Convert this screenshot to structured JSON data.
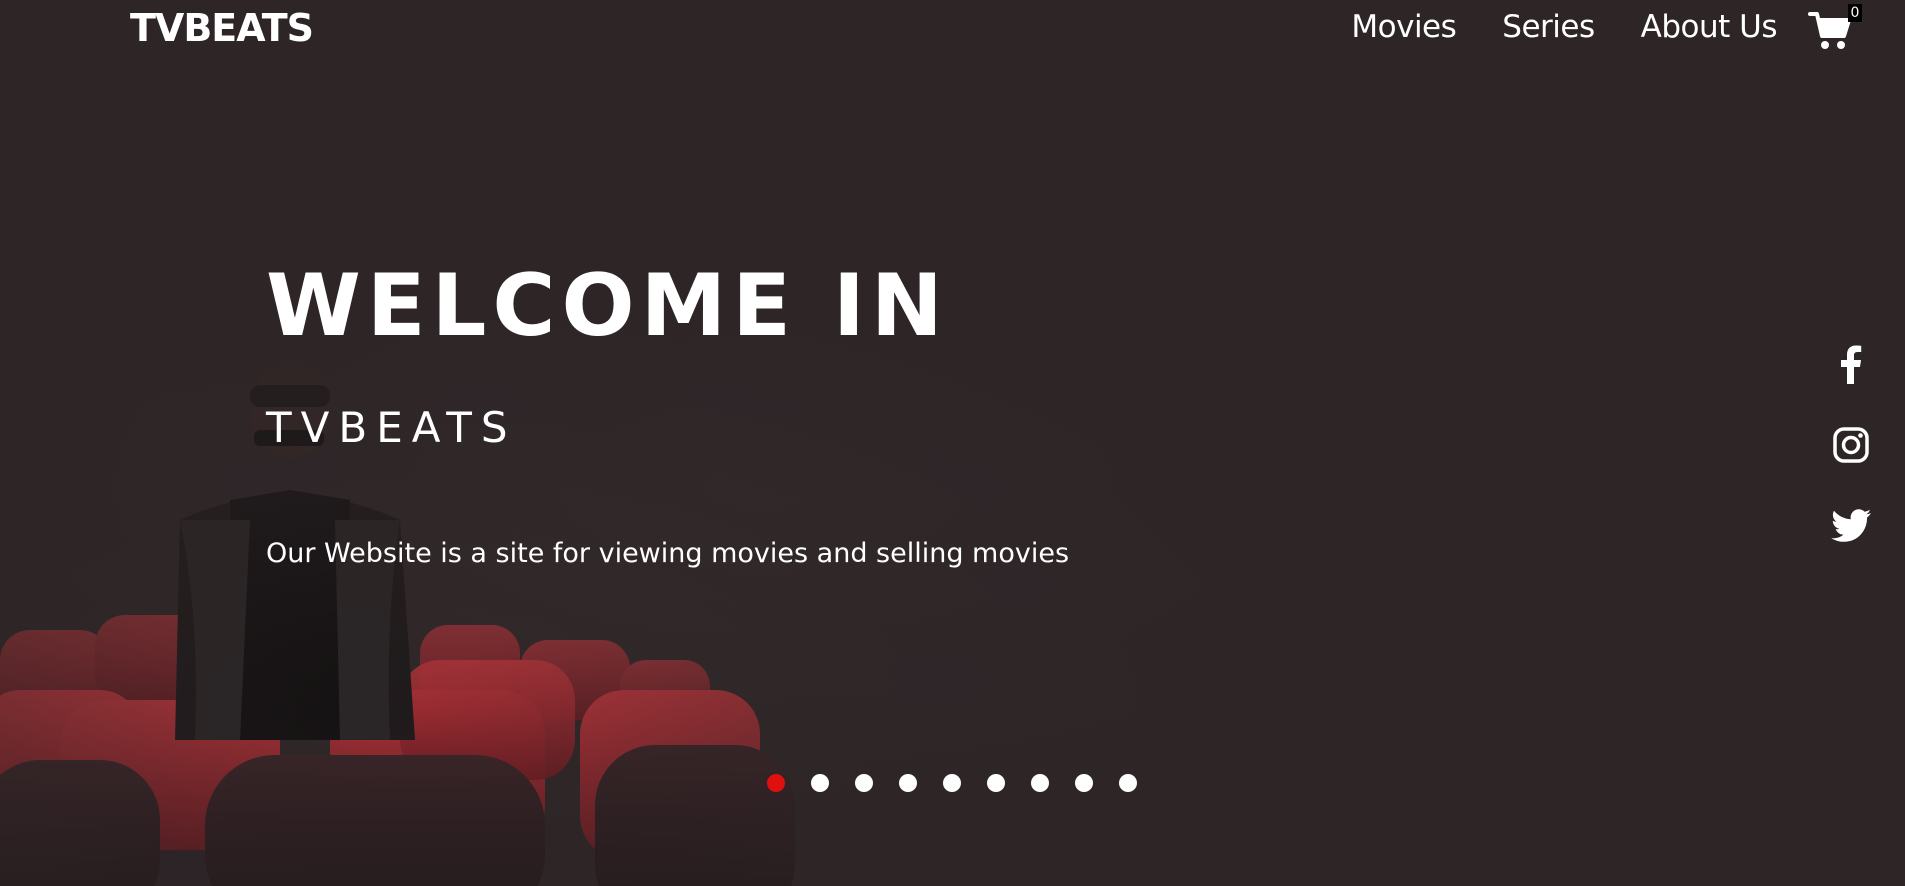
{
  "header": {
    "logo": "TVBEATS",
    "nav": [
      {
        "label": "Movies"
      },
      {
        "label": "Series"
      },
      {
        "label": "About Us"
      }
    ],
    "cart_count": "0",
    "cart_icon": "cart-icon"
  },
  "hero": {
    "title": "WELCOME IN",
    "subtitle": "TVBEATS",
    "description": "Our Website is a site for viewing movies and selling movies"
  },
  "social": [
    {
      "icon": "facebook-icon"
    },
    {
      "icon": "instagram-icon"
    },
    {
      "icon": "twitter-icon"
    }
  ],
  "slider": {
    "total_slides": 9,
    "active_index": 0
  },
  "colors": {
    "background": "#2d2526",
    "seat_red": "#9e2a30",
    "active_dot": "#e01010",
    "text": "#ffffff"
  }
}
